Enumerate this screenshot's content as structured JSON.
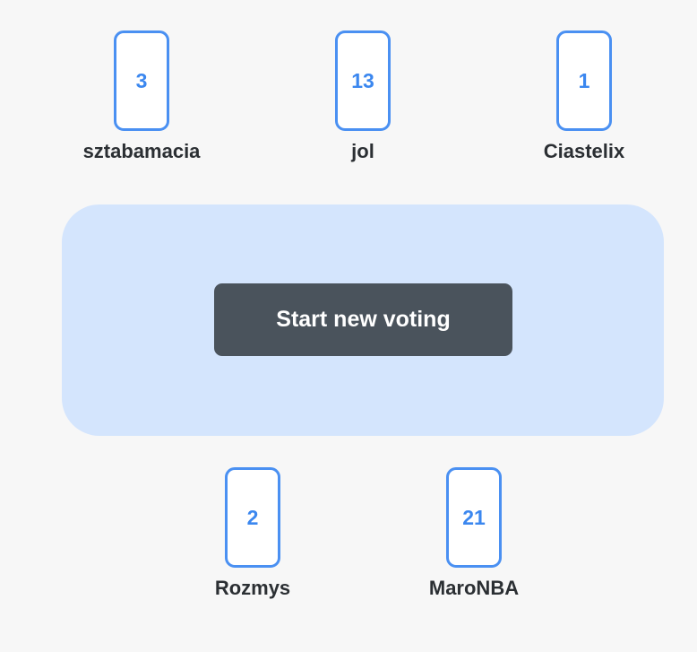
{
  "players_top": [
    {
      "name": "sztabamacia",
      "vote": "3"
    },
    {
      "name": "jol",
      "vote": "13"
    },
    {
      "name": "Ciastelix",
      "vote": "1"
    }
  ],
  "players_bottom": [
    {
      "name": "Rozmys",
      "vote": "2"
    },
    {
      "name": "MaroNBA",
      "vote": "21"
    }
  ],
  "table": {
    "start_button_label": "Start new voting"
  },
  "colors": {
    "background": "#f7f7f7",
    "card_border": "#4a90f2",
    "card_text": "#3b87ef",
    "table": "#d4e5fd",
    "button": "#4a535c",
    "name_text": "#2b2f33"
  }
}
